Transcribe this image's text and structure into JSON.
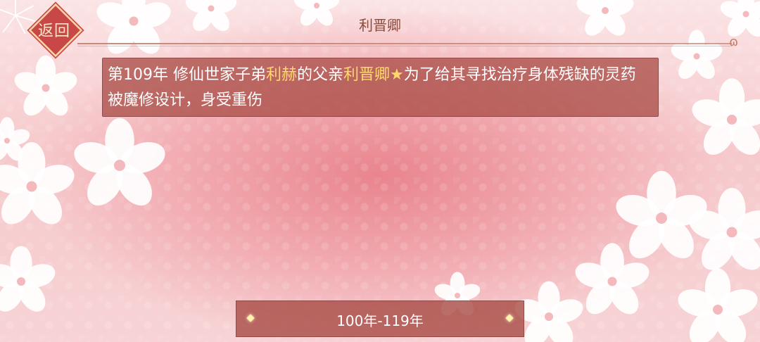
{
  "header": {
    "back_label": "返回",
    "title": "利晋卿"
  },
  "event": {
    "part1": "第109年 修仙世家子弟",
    "name1": "利赫",
    "part2": "的父亲",
    "name2": "利晋卿",
    "star": "★",
    "part3": "为了给其寻找治疗身体残缺的灵药被魔修设计，身受重伤"
  },
  "footer": {
    "range_label": "100年-119年"
  },
  "colors": {
    "card_bg": "#aa4e48",
    "highlight": "#ffd96a",
    "back_button": "#c84848"
  }
}
